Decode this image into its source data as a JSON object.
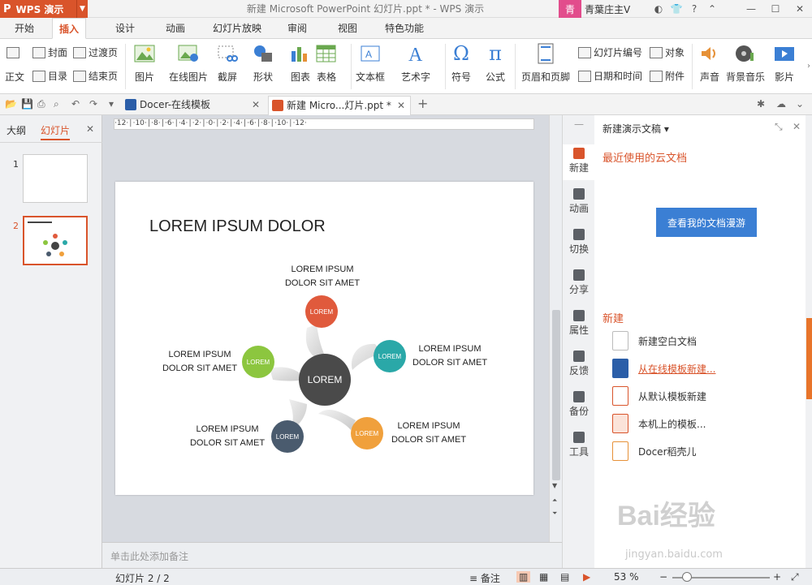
{
  "app": {
    "name": "WPS 演示",
    "doc_title": "新建 Microsoft PowerPoint 幻灯片.ppt * - WPS 演示"
  },
  "user": {
    "avatar_text": "青",
    "name": "青葉庄主V"
  },
  "menu_tabs": [
    "开始",
    "插入",
    "设计",
    "动画",
    "幻灯片放映",
    "审阅",
    "视图",
    "特色功能"
  ],
  "ribbon": {
    "cover": "封面",
    "transition_page": "过渡页",
    "body": "正文",
    "toc": "目录",
    "end_page": "结束页",
    "picture": "图片",
    "online_picture": "在线图片",
    "screenshot": "截屏",
    "shape": "形状",
    "chart": "图表",
    "table": "表格",
    "textbox": "文本框",
    "wordart": "艺术字",
    "symbol": "符号",
    "formula": "公式",
    "header_footer": "页眉和页脚",
    "slide_number": "幻灯片编号",
    "object": "对象",
    "datetime": "日期和时间",
    "attachment": "附件",
    "sound": "声音",
    "bg_music": "背景音乐",
    "movie": "影片"
  },
  "doc_tabs": [
    "Docer-在线模板",
    "新建 Micro...灯片.ppt *"
  ],
  "left_panel": {
    "tab_outline": "大纲",
    "tab_slides": "幻灯片",
    "slide_nums": [
      "1",
      "2"
    ]
  },
  "ruler_text": "·12·│·10·│·8·│·6·│·4·│·2·│·0·│·2·│·4·│·6·│·8·│·10·│·12·",
  "slide": {
    "title": "LOREM IPSUM DOLOR",
    "center": "LOREM",
    "node_label": "LOREM",
    "label_line1": "LOREM IPSUM",
    "label_line2": "DOLOR SIT AMET"
  },
  "colors": {
    "red": "#e05a3c",
    "teal": "#2aa8a8",
    "orange": "#f0a03c",
    "navy": "#4a5b6e",
    "green": "#8cc63f",
    "dark": "#4a4a4a",
    "accent": "#d9542b",
    "blue_btn": "#3b7fd4"
  },
  "notes_placeholder": "单击此处添加备注",
  "side_icons": [
    "新建",
    "动画",
    "切换",
    "分享",
    "属性",
    "反馈",
    "备份",
    "工具"
  ],
  "rpane": {
    "header": "新建演示文稿 ▾",
    "recent_title": "最近使用的云文档",
    "cloud_button": "查看我的文档漫游",
    "new_title": "新建",
    "items": [
      "新建空白文档",
      "从在线模板新建...",
      "从默认模板新建",
      "本机上的模板...",
      "Docer稻壳儿"
    ]
  },
  "status": {
    "slide_info": "幻灯片 2 / 2",
    "notes": "备注",
    "zoom": "53 %"
  },
  "watermark": {
    "brand": "Bai经验",
    "url": "jingyan.baidu.com"
  }
}
